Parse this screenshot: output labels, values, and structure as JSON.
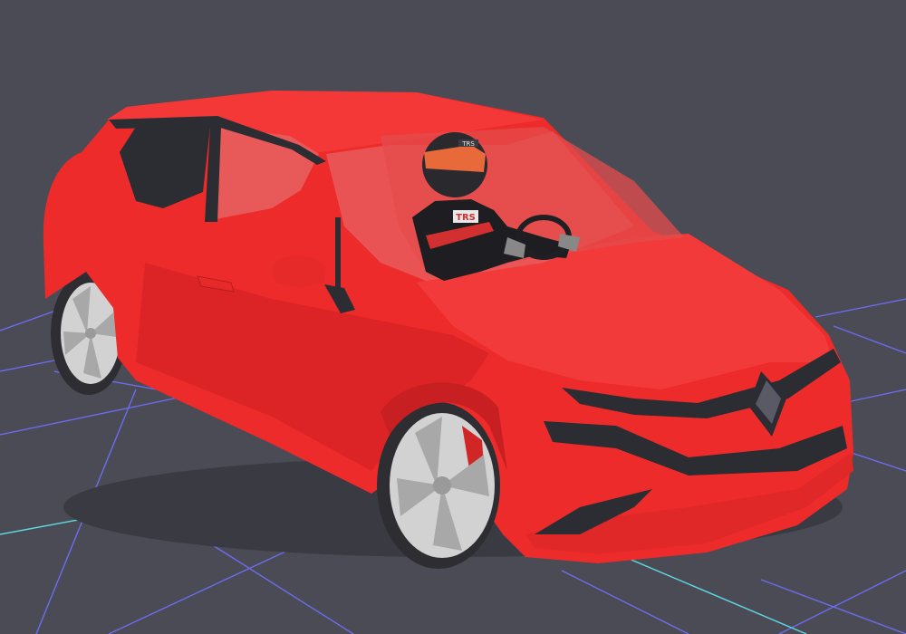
{
  "viewport": {
    "background": "#4b4b55",
    "grid_color": "#6c6cf0",
    "grid_axis_color": "#5fd8e0"
  },
  "car": {
    "body_color": "#ee2b2b",
    "body_shade": "#c81f22",
    "body_highlight": "#ff5555",
    "trim_color": "#2b2d33",
    "wheel_color": "#d2d2d2",
    "tire_color": "#2e2e32",
    "brake_color": "#d12626",
    "window_tint": "#e85a5a"
  },
  "driver": {
    "suit_color": "#1d1d22",
    "suit_accent": "#d23030",
    "helmet_color": "#2a2a2e",
    "helmet_visor": "#e86a3a",
    "suit_text": "TRS",
    "helmet_text": "TRS"
  },
  "icons": {
    "logo": "diamond-badge-icon"
  }
}
